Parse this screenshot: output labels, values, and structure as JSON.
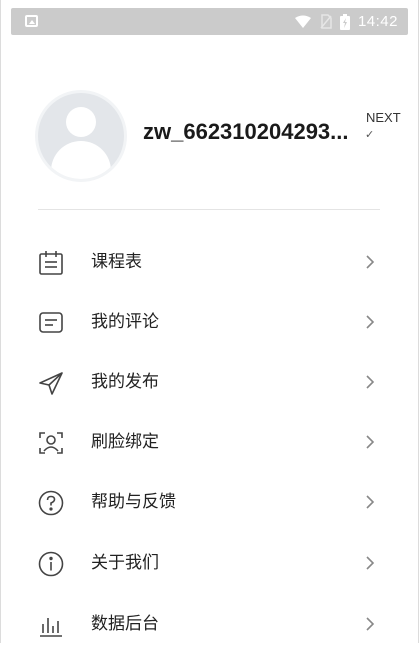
{
  "status_bar": {
    "time": "14:42",
    "icons": [
      "image-icon",
      "wifi-icon",
      "no-sim-icon",
      "battery-charging-icon"
    ]
  },
  "profile": {
    "username": "zw_662310204293...",
    "next_label": "NEXT",
    "avatar_icon": "default-avatar-icon"
  },
  "menu": {
    "items": [
      {
        "label": "课程表",
        "icon": "calendar-icon"
      },
      {
        "label": "我的评论",
        "icon": "comment-icon"
      },
      {
        "label": "我的发布",
        "icon": "send-icon"
      },
      {
        "label": "刷脸绑定",
        "icon": "face-scan-icon"
      },
      {
        "label": "帮助与反馈",
        "icon": "help-icon"
      },
      {
        "label": "关于我们",
        "icon": "info-icon"
      },
      {
        "label": "数据后台",
        "icon": "bar-chart-icon"
      }
    ]
  },
  "colors": {
    "status_bar_bg": "#cbcbcb",
    "icon_stroke": "#444444",
    "chevron": "#888888",
    "divider": "#e4e4e4"
  }
}
